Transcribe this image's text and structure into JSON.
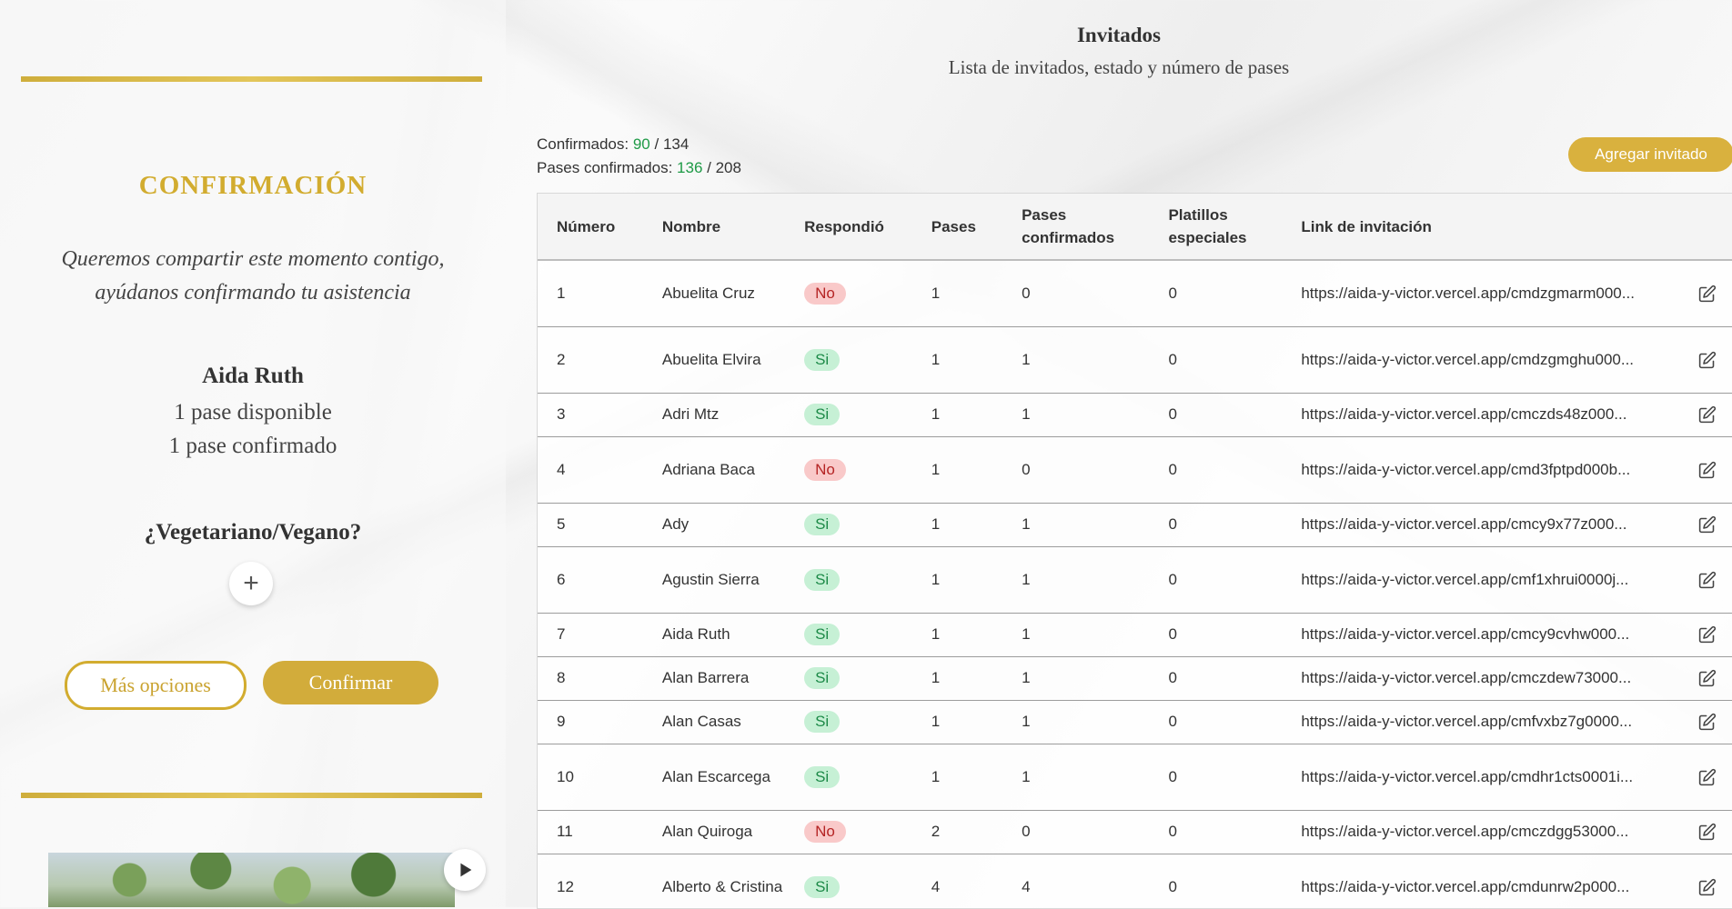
{
  "sidebar": {
    "title": "CONFIRMACIÓN",
    "message_line1": "Queremos compartir este momento contigo,",
    "message_line2": "ayúdanos confirmando tu asistencia",
    "guest_name": "Aida Ruth",
    "passes_available": "1 pase disponible",
    "passes_confirmed": "1 pase confirmado",
    "diet_question": "¿Vegetariano/Vegano?",
    "plus_label": "+",
    "more_options_label": "Más opciones",
    "confirm_label": "Confirmar",
    "accent_color": "#d2ac2f"
  },
  "header": {
    "title": "Invitados",
    "subtitle": "Lista de invitados, estado y número de pases"
  },
  "stats": {
    "confirmed_label": "Confirmados:",
    "confirmed_value": "90",
    "confirmed_total": "/ 134",
    "passes_label": "Pases confirmados:",
    "passes_value": "136",
    "passes_total": "/ 208"
  },
  "toolbar": {
    "add_guest_label": "Agregar invitado"
  },
  "table": {
    "columns": [
      "Número",
      "Nombre",
      "Respondió",
      "Pases",
      "Pases confirmados",
      "Platillos especiales",
      "Link de invitación"
    ],
    "rows": [
      {
        "num": "1",
        "name": "Abuelita Cruz",
        "responded": "No",
        "passes": "1",
        "confirmed": "0",
        "special": "0",
        "link": "https://aida-y-victor.vercel.app/cmdzgmarm000..."
      },
      {
        "num": "2",
        "name": "Abuelita Elvira",
        "responded": "Si",
        "passes": "1",
        "confirmed": "1",
        "special": "0",
        "link": "https://aida-y-victor.vercel.app/cmdzgmghu000..."
      },
      {
        "num": "3",
        "name": "Adri Mtz",
        "responded": "Si",
        "passes": "1",
        "confirmed": "1",
        "special": "0",
        "link": "https://aida-y-victor.vercel.app/cmczds48z000..."
      },
      {
        "num": "4",
        "name": "Adriana Baca",
        "responded": "No",
        "passes": "1",
        "confirmed": "0",
        "special": "0",
        "link": "https://aida-y-victor.vercel.app/cmd3fptpd000b..."
      },
      {
        "num": "5",
        "name": "Ady",
        "responded": "Si",
        "passes": "1",
        "confirmed": "1",
        "special": "0",
        "link": "https://aida-y-victor.vercel.app/cmcy9x77z000..."
      },
      {
        "num": "6",
        "name": "Agustin Sierra",
        "responded": "Si",
        "passes": "1",
        "confirmed": "1",
        "special": "0",
        "link": "https://aida-y-victor.vercel.app/cmf1xhrui0000j..."
      },
      {
        "num": "7",
        "name": "Aida Ruth",
        "responded": "Si",
        "passes": "1",
        "confirmed": "1",
        "special": "0",
        "link": "https://aida-y-victor.vercel.app/cmcy9cvhw000..."
      },
      {
        "num": "8",
        "name": "Alan Barrera",
        "responded": "Si",
        "passes": "1",
        "confirmed": "1",
        "special": "0",
        "link": "https://aida-y-victor.vercel.app/cmczdew73000..."
      },
      {
        "num": "9",
        "name": "Alan Casas",
        "responded": "Si",
        "passes": "1",
        "confirmed": "1",
        "special": "0",
        "link": "https://aida-y-victor.vercel.app/cmfvxbz7g0000..."
      },
      {
        "num": "10",
        "name": "Alan Escarcega",
        "responded": "Si",
        "passes": "1",
        "confirmed": "1",
        "special": "0",
        "link": "https://aida-y-victor.vercel.app/cmdhr1cts0001i..."
      },
      {
        "num": "11",
        "name": "Alan Quiroga",
        "responded": "No",
        "passes": "2",
        "confirmed": "0",
        "special": "0",
        "link": "https://aida-y-victor.vercel.app/cmczdgg53000..."
      },
      {
        "num": "12",
        "name": "Alberto & Cristina",
        "responded": "Si",
        "passes": "4",
        "confirmed": "4",
        "special": "0",
        "link": "https://aida-y-victor.vercel.app/cmdunrw2p000..."
      }
    ]
  },
  "icons": {
    "edit": "edit-icon",
    "play": "play-icon",
    "plus": "plus-icon"
  }
}
